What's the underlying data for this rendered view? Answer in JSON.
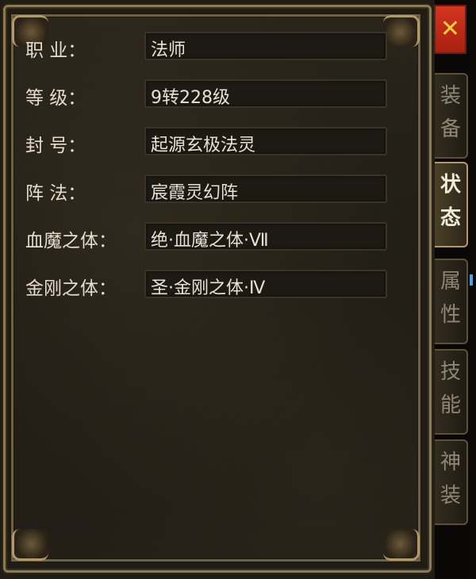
{
  "rows": [
    {
      "label": "职    业：",
      "value": "法师"
    },
    {
      "label": "等    级：",
      "value": "9转228级"
    },
    {
      "label": "封    号：",
      "value": "起源玄极法灵"
    },
    {
      "label": "阵    法：",
      "value": "宸霞灵幻阵"
    },
    {
      "label": "血魔之体：",
      "value": "绝·血魔之体·Ⅶ"
    },
    {
      "label": "金刚之体：",
      "value": "圣·金刚之体·Ⅳ"
    }
  ],
  "close": {
    "symbol": "✕"
  },
  "tabs": [
    {
      "c1": "装",
      "c2": "备",
      "active": false
    },
    {
      "c1": "状",
      "c2": "态",
      "active": true
    },
    {
      "c1": "属",
      "c2": "性",
      "active": false
    },
    {
      "c1": "技",
      "c2": "能",
      "active": false
    },
    {
      "c1": "神",
      "c2": "装",
      "active": false
    }
  ],
  "colors": {
    "close_bg": "#c42a18",
    "close_x": "#f4cf45",
    "active_tab_border": "#b39a62"
  }
}
